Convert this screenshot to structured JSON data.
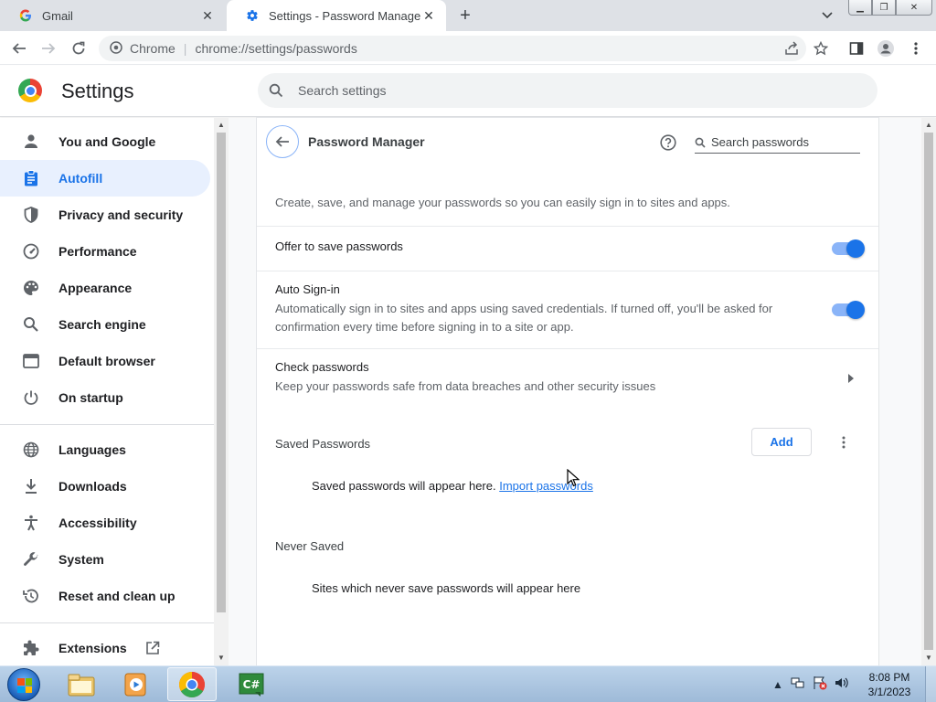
{
  "tabs": [
    {
      "title": "Gmail",
      "favicon": "google-g-icon"
    },
    {
      "title": "Settings - Password Manager",
      "favicon": "settings-gear-icon"
    }
  ],
  "toolbar": {
    "origin_label": "Chrome",
    "url": "chrome://settings/passwords"
  },
  "header": {
    "title": "Settings",
    "search_placeholder": "Search settings"
  },
  "sidebar": {
    "items": [
      {
        "label": "You and Google",
        "icon": "person-icon"
      },
      {
        "label": "Autofill",
        "icon": "clipboard-icon",
        "selected": true
      },
      {
        "label": "Privacy and security",
        "icon": "shield-icon"
      },
      {
        "label": "Performance",
        "icon": "speedometer-icon"
      },
      {
        "label": "Appearance",
        "icon": "palette-icon"
      },
      {
        "label": "Search engine",
        "icon": "search-icon"
      },
      {
        "label": "Default browser",
        "icon": "browser-window-icon"
      },
      {
        "label": "On startup",
        "icon": "power-icon"
      },
      {
        "label": "Languages",
        "icon": "globe-icon"
      },
      {
        "label": "Downloads",
        "icon": "download-icon"
      },
      {
        "label": "Accessibility",
        "icon": "accessibility-icon"
      },
      {
        "label": "System",
        "icon": "wrench-icon"
      },
      {
        "label": "Reset and clean up",
        "icon": "restore-icon"
      },
      {
        "label": "Extensions",
        "icon": "puzzle-icon"
      }
    ]
  },
  "password_manager": {
    "title": "Password Manager",
    "search_placeholder": "Search passwords",
    "description": "Create, save, and manage your passwords so you can easily sign in to sites and apps.",
    "offer_to_save": {
      "label": "Offer to save passwords",
      "enabled": true
    },
    "auto_signin": {
      "label": "Auto Sign-in",
      "description_line1": "Automatically sign in to sites and apps using saved credentials. If turned off, you'll be asked for",
      "description_line2": "confirmation every time before signing in to a site or app.",
      "enabled": true
    },
    "check_passwords": {
      "label": "Check passwords",
      "description": "Keep your passwords safe from data breaches and other security issues"
    },
    "saved_passwords": {
      "heading": "Saved Passwords",
      "add_label": "Add",
      "empty_text": "Saved passwords will appear here.",
      "import_link": "Import passwords"
    },
    "never_saved": {
      "heading": "Never Saved",
      "empty_text": "Sites which never save passwords will appear here"
    }
  },
  "taskbar": {
    "apps": [
      "file-explorer-icon",
      "media-player-icon",
      "chrome-icon",
      "csharp-app-icon"
    ],
    "time": "8:08 PM",
    "date": "3/1/2023"
  },
  "colors": {
    "accent": "#1a73e8",
    "selected_bg": "#e8f0fe",
    "toggle_track": "#8ab4f8"
  }
}
